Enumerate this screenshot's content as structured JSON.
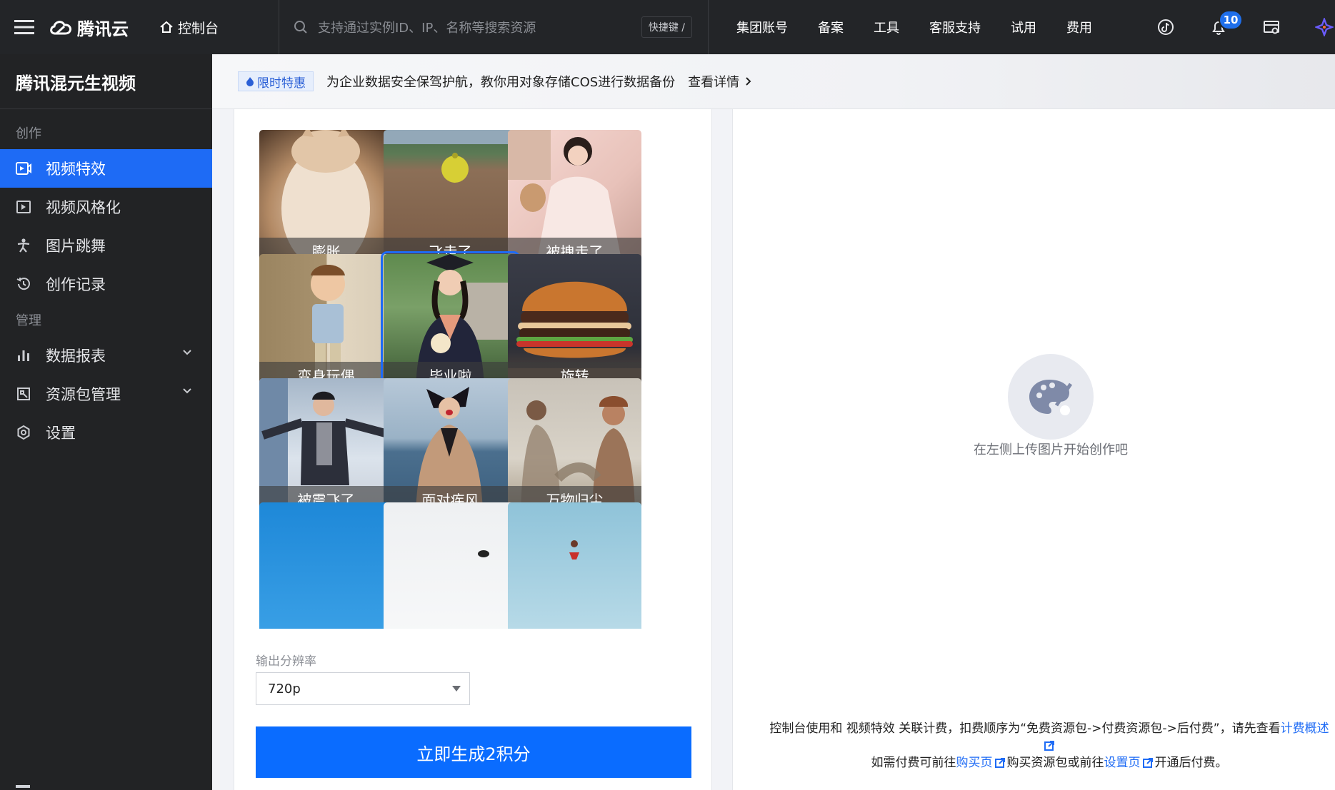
{
  "topbar": {
    "brand": "腾讯云",
    "console_label": "控制台",
    "search_placeholder": "支持通过实例ID、IP、名称等搜索资源",
    "shortcut_label": "快捷键 /",
    "nav": [
      "集团账号",
      "备案",
      "工具",
      "客服支持",
      "试用",
      "费用"
    ],
    "notification_count": "10",
    "icons": [
      "menu-icon",
      "cloud-logo-icon",
      "home-icon",
      "search-icon",
      "tiktok-icon",
      "bell-icon",
      "billing-icon",
      "app-launcher-icon"
    ]
  },
  "sidebar": {
    "title": "腾讯混元生视频",
    "groups": [
      {
        "label": "创作",
        "items": [
          {
            "label": "视频特效",
            "icon": "video-effect-icon",
            "active": true
          },
          {
            "label": "视频风格化",
            "icon": "video-style-icon"
          },
          {
            "label": "图片跳舞",
            "icon": "dance-icon"
          },
          {
            "label": "创作记录",
            "icon": "history-icon"
          }
        ]
      },
      {
        "label": "管理",
        "items": [
          {
            "label": "数据报表",
            "icon": "chart-icon",
            "expandable": true
          },
          {
            "label": "资源包管理",
            "icon": "package-icon",
            "expandable": true
          },
          {
            "label": "设置",
            "icon": "settings-icon"
          }
        ]
      }
    ]
  },
  "banner": {
    "tag": "限时特惠",
    "message": "为企业数据安全保驾护航，教你用对象存储COS进行数据备份",
    "link": "查看详情"
  },
  "effects": [
    {
      "label": "膨胀",
      "theme": "cat"
    },
    {
      "label": "飞走了",
      "theme": "ball"
    },
    {
      "label": "被拽走了",
      "theme": "girl"
    },
    {
      "label": "变身玩偶",
      "theme": "doll"
    },
    {
      "label": "毕业啦",
      "theme": "graduate",
      "selected": true
    },
    {
      "label": "旋转",
      "theme": "burger"
    },
    {
      "label": "被震飞了",
      "theme": "jump"
    },
    {
      "label": "面对疾风",
      "theme": "wind"
    },
    {
      "label": "万物归尘",
      "theme": "dust"
    },
    {
      "label": "",
      "theme": "sky"
    },
    {
      "label": "",
      "theme": "snow"
    },
    {
      "label": "",
      "theme": "beach"
    }
  ],
  "form": {
    "resolution_label": "输出分辨率",
    "resolution_value": "720p",
    "generate_label": "立即生成2积分"
  },
  "preview": {
    "empty_text": "在左侧上传图片开始创作吧",
    "billing_text_1": "控制台使用和 视频特效 关联计费，扣费顺序为“免费资源包->付费资源包->后付费”，请先查看",
    "billing_link_1": "计费概述",
    "billing_text_2": "如需付费可前往",
    "billing_link_2": "购买页",
    "billing_text_3": "购买资源包或前往",
    "billing_link_3": "设置页",
    "billing_text_4": "开通后付费。"
  },
  "colors": {
    "accent": "#1e6bf5",
    "topbar": "#232528",
    "sidebar": "#222325"
  }
}
